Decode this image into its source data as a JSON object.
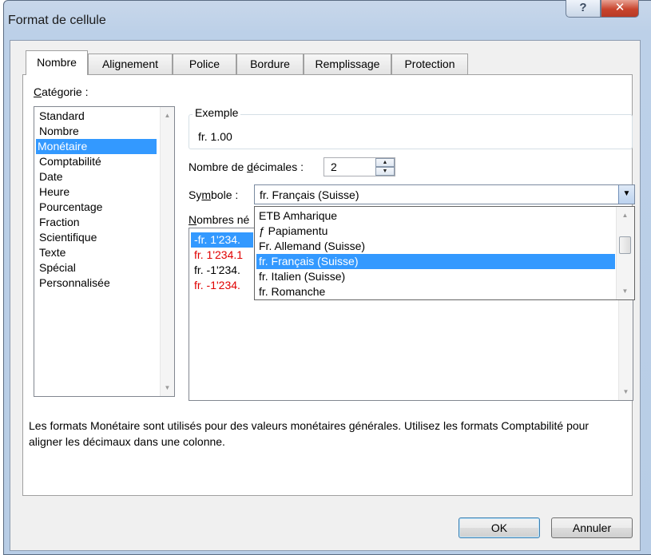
{
  "window": {
    "title": "Format de cellule",
    "help_icon": "question-mark-icon",
    "close_icon": "close-x-icon"
  },
  "tabs": [
    {
      "label": "Nombre",
      "active": true
    },
    {
      "label": "Alignement"
    },
    {
      "label": "Police"
    },
    {
      "label": "Bordure"
    },
    {
      "label": "Remplissage"
    },
    {
      "label": "Protection"
    }
  ],
  "category": {
    "label_u": "C",
    "label_rest": "atégorie :",
    "items": [
      "Standard",
      "Nombre",
      "Monétaire",
      "Comptabilité",
      "Date",
      "Heure",
      "Pourcentage",
      "Fraction",
      "Scientifique",
      "Texte",
      "Spécial",
      "Personnalisée"
    ],
    "selected": "Monétaire"
  },
  "example": {
    "label": "Exemple",
    "value": "fr. 1.00"
  },
  "decimals": {
    "label_pre": "Nombre de ",
    "label_u": "d",
    "label_post": "écimales :",
    "value": "2"
  },
  "symbol": {
    "label_pre": "Sy",
    "label_u": "m",
    "label_post": "bole :",
    "value": "fr. Français (Suisse)"
  },
  "negatives": {
    "label_u": "N",
    "label_rest": "ombres né",
    "items": [
      {
        "text": "-fr. 1'234.",
        "style": "selected"
      },
      {
        "text": "fr. 1'234.1",
        "style": "red"
      },
      {
        "text": "fr. -1'234.",
        "style": "normal"
      },
      {
        "text": "fr. -1'234.",
        "style": "red"
      }
    ]
  },
  "dropdown": {
    "options": [
      "ETB Amharique",
      "ƒ Papiamentu",
      "Fr. Allemand (Suisse)",
      "fr. Français (Suisse)",
      "fr. Italien (Suisse)",
      "fr. Romanche"
    ],
    "selected": "fr. Français (Suisse)"
  },
  "description": "Les formats Monétaire sont utilisés pour des valeurs monétaires générales. Utilisez les formats Comptabilité pour aligner les décimaux dans une colonne.",
  "buttons": {
    "ok": "OK",
    "cancel": "Annuler"
  },
  "colors": {
    "selection": "#3399ff",
    "negative_red": "#e00000"
  }
}
